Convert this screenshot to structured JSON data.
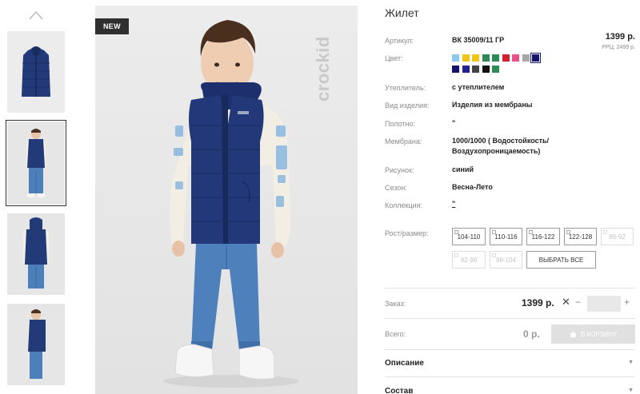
{
  "thumbnails": {
    "up_icon": "chevron-up-icon",
    "items": [
      "vest",
      "kid-front",
      "kid-back",
      "kid-side"
    ],
    "active_index": 1
  },
  "photo": {
    "badge": "NEW",
    "brand": "crockid"
  },
  "product": {
    "title": "Жилет",
    "price": "1399 р.",
    "rrp": "РРЦ: 2499 р.",
    "specs": [
      {
        "label": "Артикул:",
        "value": "ВК 35009/11 ГР"
      },
      {
        "label": "Цвет:",
        "value": ""
      },
      {
        "label": "Утеплитель:",
        "value": "с утеплителем"
      },
      {
        "label": "Вид изделия:",
        "value": "Изделия из мембраны"
      },
      {
        "label": "Полотно:",
        "value": "\""
      },
      {
        "label": "Мембрана:",
        "value": "1000/1000 ( Водостойкость/ Воздухопроницаемость)"
      },
      {
        "label": "Рисунок:",
        "value": "синий"
      },
      {
        "label": "Сезон:",
        "value": "Весна-Лето"
      },
      {
        "label": "Коллекция:",
        "value": "\""
      }
    ],
    "colors": [
      "#8cc8f0",
      "#f2c418",
      "#f2c418",
      "#2e8b57",
      "#2e8b57",
      "#d42030",
      "#e8508a",
      "#a8a8a8",
      "#14146e",
      "#14146e",
      "#202090",
      "#444444",
      "#111111",
      "#2e8b57"
    ],
    "selected_color_index": 8
  },
  "sizes": {
    "label": "Рост/размер:",
    "options": [
      {
        "label": "104-110",
        "available": true
      },
      {
        "label": "110-116",
        "available": true
      },
      {
        "label": "116-122",
        "available": true
      },
      {
        "label": "122-128",
        "available": true
      },
      {
        "label": "86-92",
        "available": false
      },
      {
        "label": "92-98",
        "available": false
      },
      {
        "label": "98-104",
        "available": false
      }
    ],
    "select_all": "ВЫБРАТЬ ВСЕ"
  },
  "order": {
    "label": "Заказ:",
    "price": "1399 р.",
    "times": "✕",
    "minus": "−",
    "plus": "+",
    "quantity": ""
  },
  "total": {
    "label": "Всего:",
    "value": "0 р.",
    "cart_label": "В КОРЗИНУ",
    "cart_icon": "cart-icon"
  },
  "accordion": {
    "description": "Описание",
    "composition": "Состав"
  },
  "accent": "#1b1b6b"
}
